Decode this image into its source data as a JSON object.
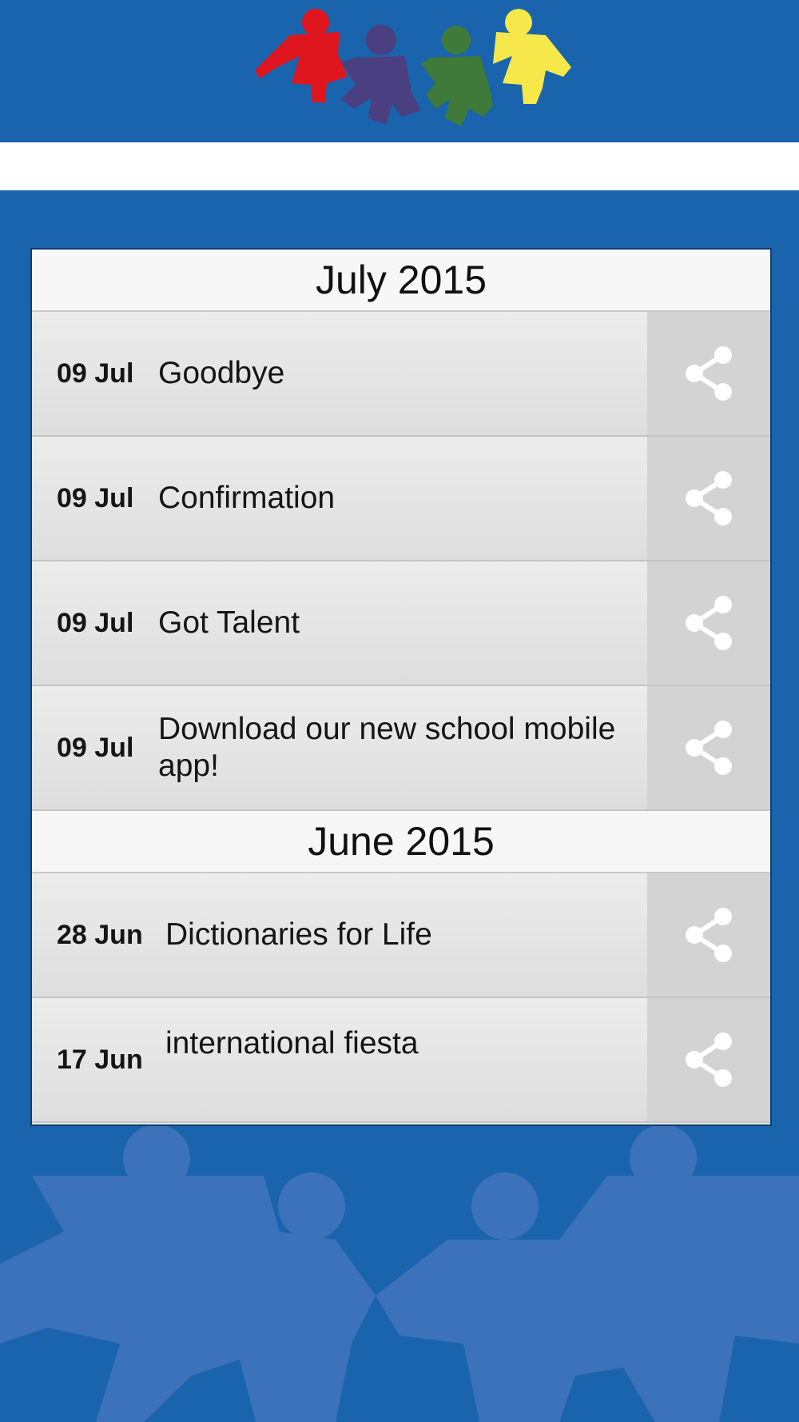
{
  "sections": [
    {
      "title": "July 2015",
      "items": [
        {
          "date": "09 Jul",
          "title": "Goodbye"
        },
        {
          "date": "09 Jul",
          "title": "Confirmation"
        },
        {
          "date": "09 Jul",
          "title": "Got Talent"
        },
        {
          "date": "09 Jul",
          "title": "Download our new school mobile app!"
        }
      ]
    },
    {
      "title": "June 2015",
      "items": [
        {
          "date": "28 Jun",
          "title": "Dictionaries for Life"
        },
        {
          "date": "17 Jun",
          "title": "international fiesta"
        }
      ]
    }
  ],
  "icons": {
    "share": "share-icon",
    "logo": "paper-dolls-logo"
  },
  "colors": {
    "background": "#1a64ad",
    "doll_red": "#e0161e",
    "doll_purple": "#4a3f80",
    "doll_green": "#3f7a3a",
    "doll_yellow": "#f6e84a"
  }
}
